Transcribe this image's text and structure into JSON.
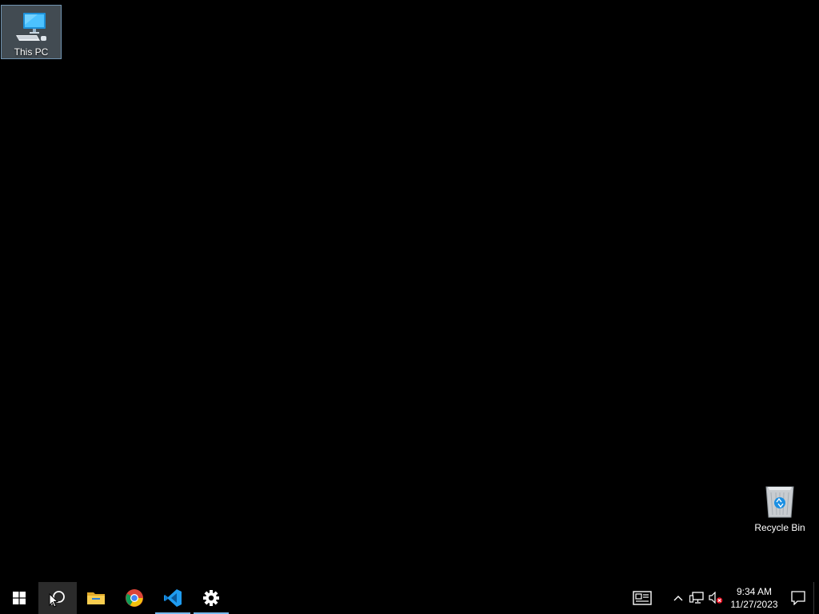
{
  "desktop": {
    "icons": [
      {
        "label": "This PC",
        "icon": "computer-icon"
      },
      {
        "label": "Recycle Bin",
        "icon": "recycle-bin-icon"
      }
    ]
  },
  "taskbar": {
    "pinned": [
      {
        "name": "Start",
        "icon": "windows-logo-icon"
      },
      {
        "name": "Search",
        "icon": "search-icon"
      },
      {
        "name": "File Explorer",
        "icon": "folder-icon"
      },
      {
        "name": "Google Chrome",
        "icon": "chrome-icon"
      },
      {
        "name": "Visual Studio Code",
        "icon": "vscode-icon"
      },
      {
        "name": "Settings",
        "icon": "gear-icon"
      }
    ],
    "tray": {
      "clock_time": "9:34 AM",
      "clock_date": "11/27/2023"
    }
  },
  "colors": {
    "background": "#000000",
    "accent": "#76b9ed",
    "selection": "#cce8ff"
  }
}
